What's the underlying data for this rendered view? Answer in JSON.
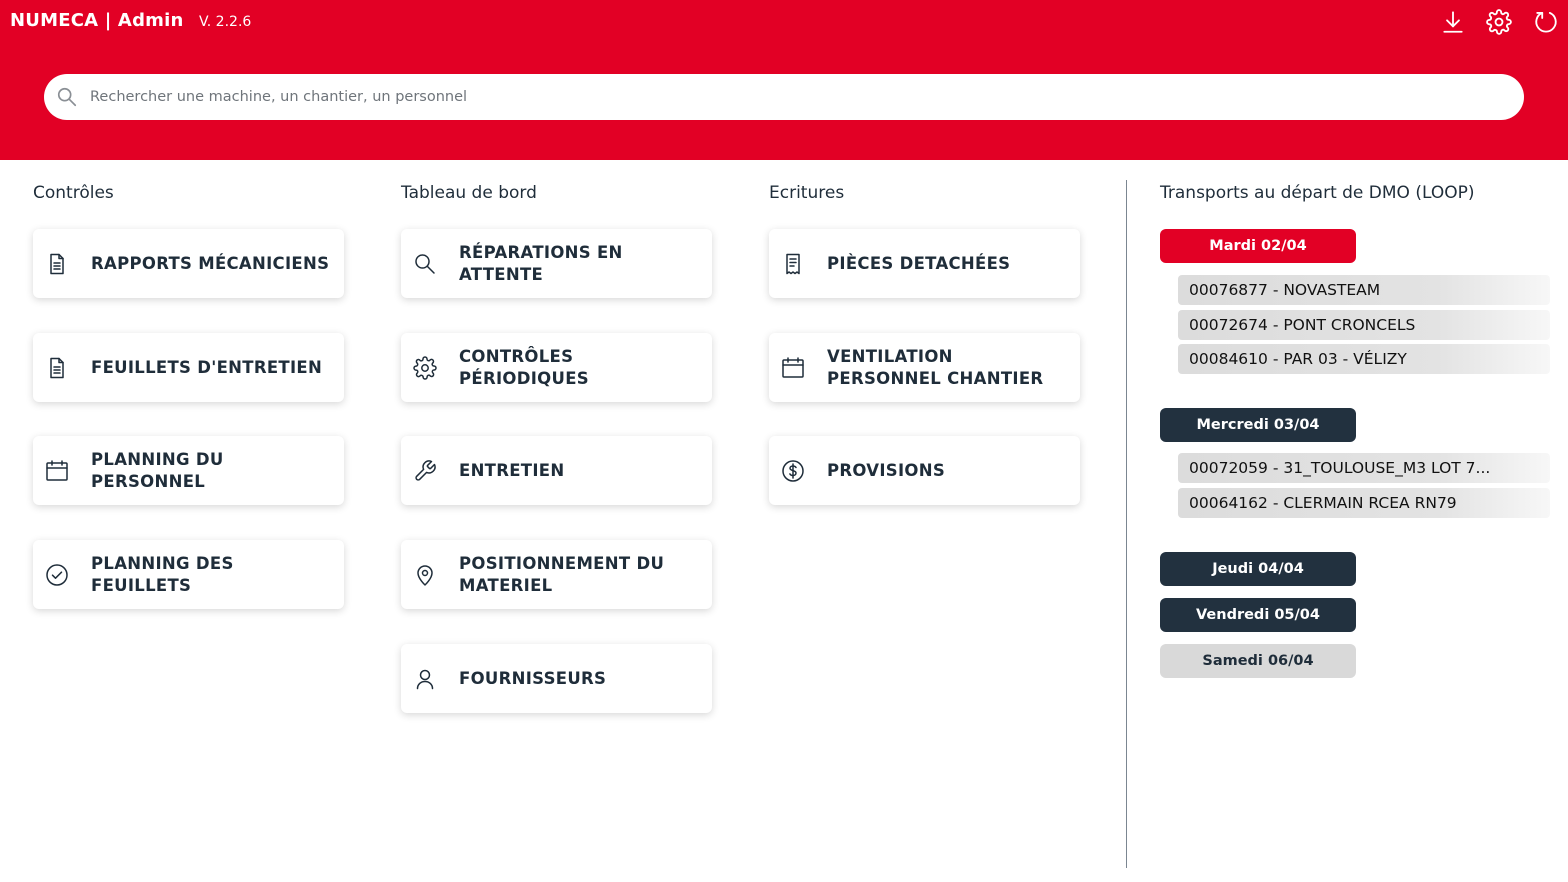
{
  "app": {
    "brand": "NUMECA | Admin",
    "version": "V. 2.2.6"
  },
  "header_icons": [
    "download-icon",
    "gear-icon",
    "refresh-icon"
  ],
  "colors": {
    "brand_red": "#e20025",
    "dark_navy": "#22313f",
    "text": "#1f2d3a"
  },
  "search": {
    "placeholder": "Rechercher une machine, un chantier, un personnel"
  },
  "columns": {
    "controles": {
      "title": "Contrôles",
      "items": [
        {
          "label": "RAPPORTS MÉCANICIENS",
          "icon": "document-icon"
        },
        {
          "label": "FEUILLETS D'ENTRETIEN",
          "icon": "document-icon"
        },
        {
          "label": "PLANNING DU PERSONNEL",
          "icon": "calendar-icon"
        },
        {
          "label": "PLANNING DES FEUILLETS",
          "icon": "check-circle-icon"
        }
      ]
    },
    "tableau": {
      "title": "Tableau de bord",
      "items": [
        {
          "label": "RÉPARATIONS EN ATTENTE",
          "icon": "search-icon"
        },
        {
          "label": "CONTRÔLES PÉRIODIQUES",
          "icon": "gear-icon"
        },
        {
          "label": "ENTRETIEN",
          "icon": "wrench-icon"
        },
        {
          "label": "POSITIONNEMENT DU MATERIEL",
          "icon": "map-pin-icon"
        },
        {
          "label": "FOURNISSEURS",
          "icon": "user-icon"
        }
      ]
    },
    "ecritures": {
      "title": "Ecritures",
      "items": [
        {
          "label": "PIÈCES DETACHÉES",
          "icon": "receipt-icon"
        },
        {
          "label": "VENTILATION PERSONNEL CHANTIER",
          "icon": "calendar-icon"
        },
        {
          "label": "PROVISIONS",
          "icon": "dollar-circle-icon"
        }
      ]
    }
  },
  "transports": {
    "title": "Transports au départ de DMO (LOOP)",
    "days": [
      {
        "label": "Mardi 02/04",
        "state": "active",
        "items": [
          "00076877 - NOVASTEAM",
          "00072674 - PONT CRONCELS",
          "00084610 - PAR 03 - VÉLIZY"
        ]
      },
      {
        "label": "Mercredi 03/04",
        "state": "dark",
        "items": [
          "00072059 - 31_TOULOUSE_M3 LOT 7...",
          "00064162 - CLERMAIN RCEA RN79"
        ]
      },
      {
        "label": "Jeudi 04/04",
        "state": "dark",
        "items": []
      },
      {
        "label": "Vendredi 05/04",
        "state": "dark",
        "items": []
      },
      {
        "label": "Samedi 06/04",
        "state": "light",
        "items": []
      }
    ]
  }
}
